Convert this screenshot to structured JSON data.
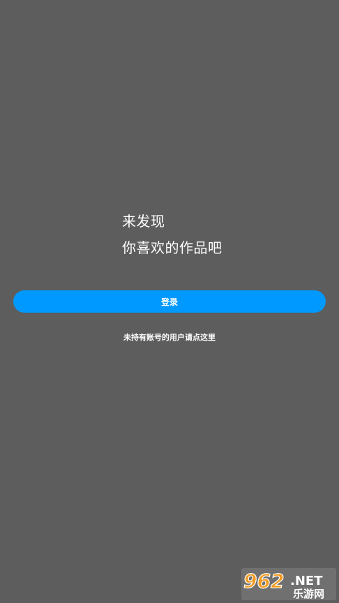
{
  "intro": {
    "line1": "来发现",
    "line2": "你喜欢的作品吧"
  },
  "login": {
    "label": "登录"
  },
  "register": {
    "label": "未持有账号的用户请点这里"
  },
  "watermark": {
    "brand_number": "962",
    "brand_suffix": ".NET",
    "brand_cn": "乐游网"
  },
  "colors": {
    "background": "#5d5d5d",
    "accent": "#0099ff",
    "text": "#ffffff"
  }
}
